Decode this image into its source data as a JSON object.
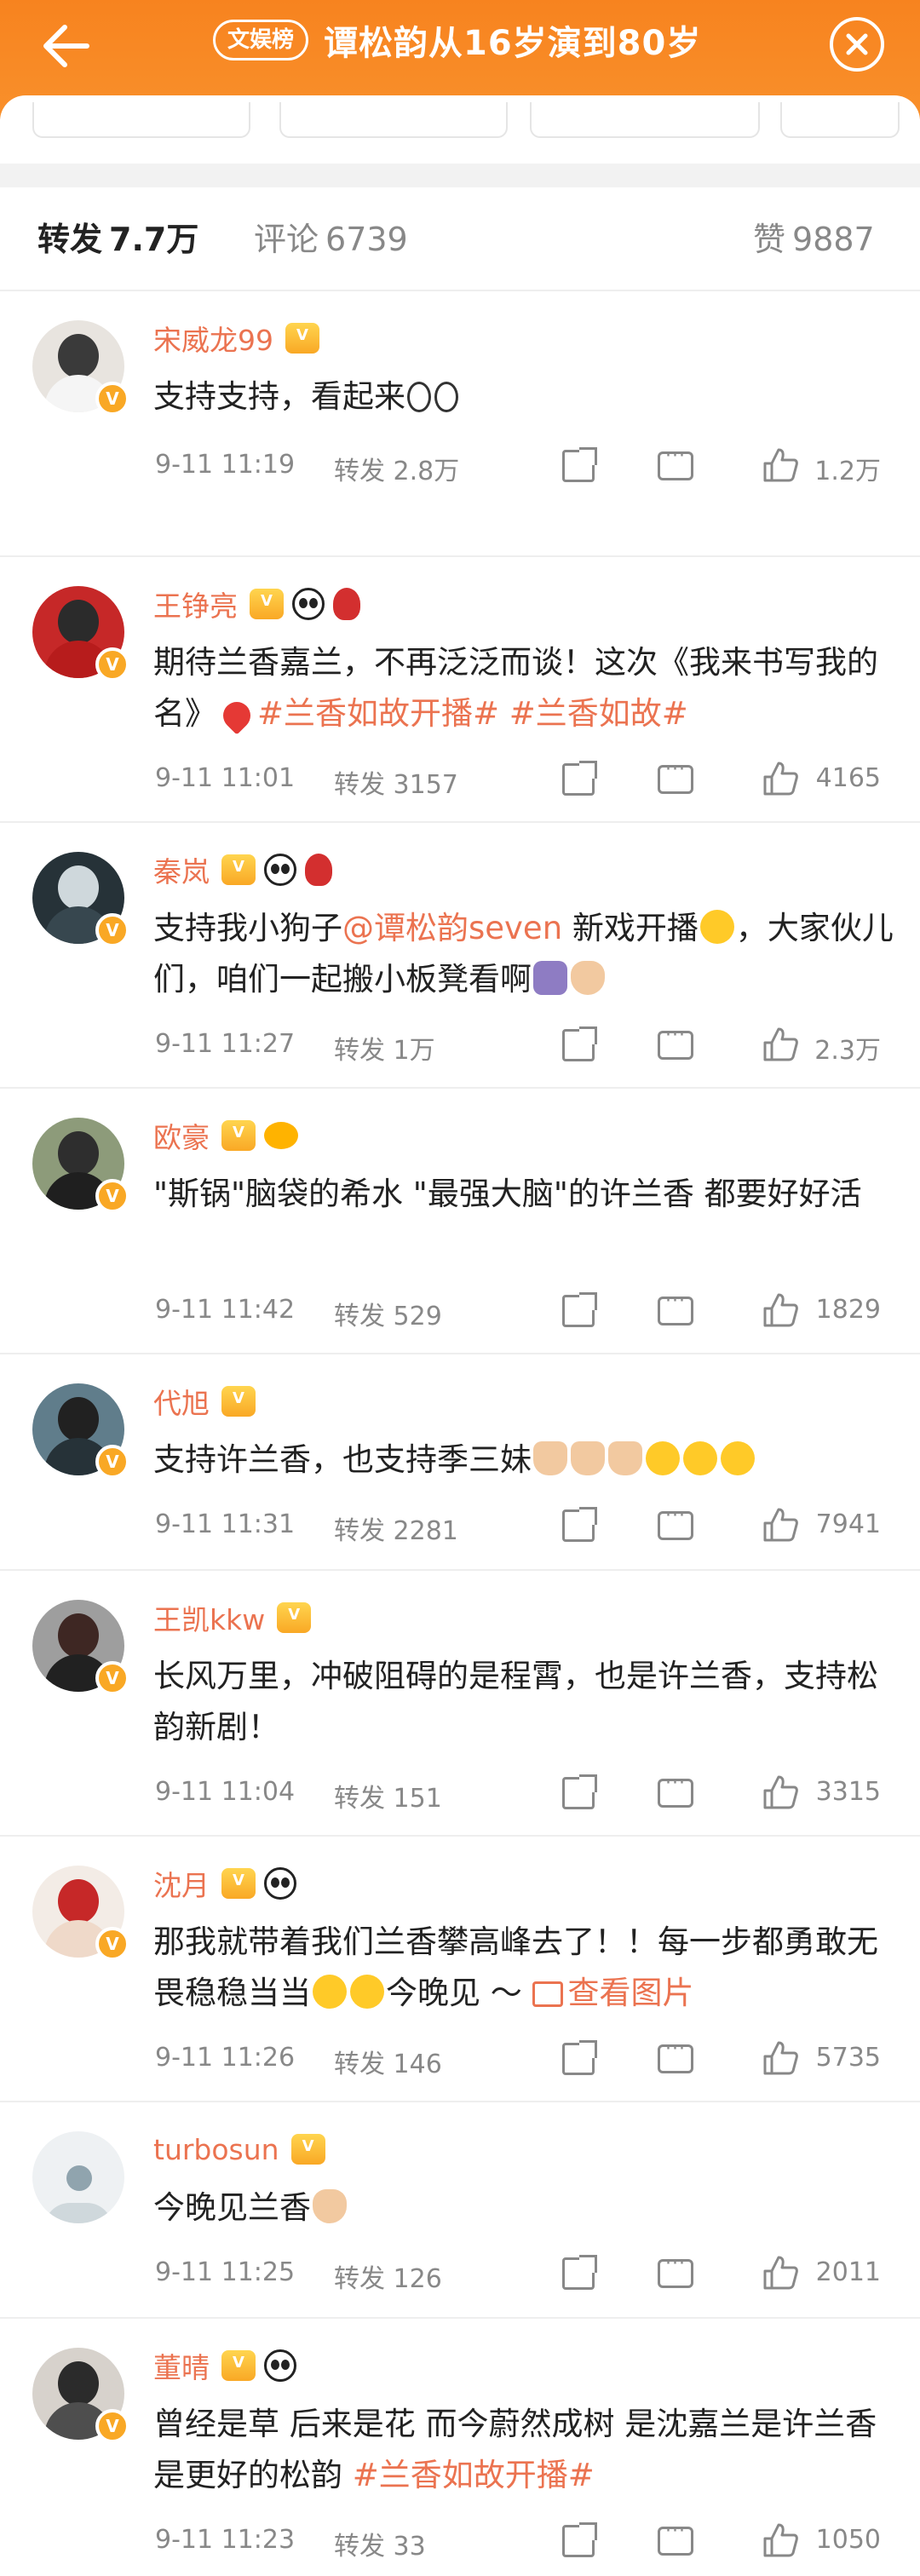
{
  "header": {
    "badge": "文娱榜",
    "title": "谭松韵从16岁演到80岁",
    "topbar_color": "#f7831f"
  },
  "tabs": {
    "forward_label": "转发",
    "forward_count": "7.7万",
    "comment_label": "评论",
    "comment_count": "6739",
    "like_label": "赞",
    "like_count": "9887"
  },
  "meta_labels": {
    "forward": "转发"
  },
  "comments": [
    {
      "name": "宋威龙99",
      "text": "支持支持，看起来",
      "time": "9-11 11:19",
      "forwards": "2.8万",
      "likes": "1.2万"
    },
    {
      "name": "王铮亮",
      "text_a": "期待兰香嘉兰，不再泛泛而谈！这次《我来书写我的名》",
      "tag1": "#兰香如故开播#",
      "tag2": "#兰香如故#",
      "time": "9-11 11:01",
      "forwards": "3157",
      "likes": "4165"
    },
    {
      "name": "秦岚",
      "text_a": "支持我小狗子",
      "mention": "@谭松韵seven",
      "text_b": "新戏开播",
      "text_c": "，大家伙儿们，咱们一起搬小板凳看啊",
      "time": "9-11 11:27",
      "forwards": "1万",
      "likes": "2.3万"
    },
    {
      "name": "欧豪",
      "text": "\"斯锅\"脑袋的希水 \"最强大脑\"的许兰香 都要好好活",
      "time": "9-11 11:42",
      "forwards": "529",
      "likes": "1829"
    },
    {
      "name": "代旭",
      "text": "支持许兰香，也支持季三妹",
      "time": "9-11 11:31",
      "forwards": "2281",
      "likes": "7941"
    },
    {
      "name": "王凯kkw",
      "text": "长风万里，冲破阻碍的是程霄，也是许兰香，支持松韵新剧！",
      "time": "9-11 11:04",
      "forwards": "151",
      "likes": "3315"
    },
    {
      "name": "沈月",
      "text_a": "那我就带着我们兰香攀高峰去了！！每一步都勇敢无畏稳稳当当",
      "text_b": "今晚见 ～",
      "view_img": "查看图片",
      "time": "9-11 11:26",
      "forwards": "146",
      "likes": "5735"
    },
    {
      "name": "turbosun",
      "text": "今晚见兰香",
      "time": "9-11 11:25",
      "forwards": "126",
      "likes": "2011"
    },
    {
      "name": "董晴",
      "text_a": "曾经是草 后来是花 而今蔚然成树 是沈嘉兰是许兰香 是更好的松韵",
      "tag1": "#兰香如故开播#",
      "time": "9-11 11:23",
      "forwards": "33",
      "likes": "1050"
    }
  ],
  "colors": {
    "accent": "#eb7350",
    "meta_gray": "#888888"
  }
}
